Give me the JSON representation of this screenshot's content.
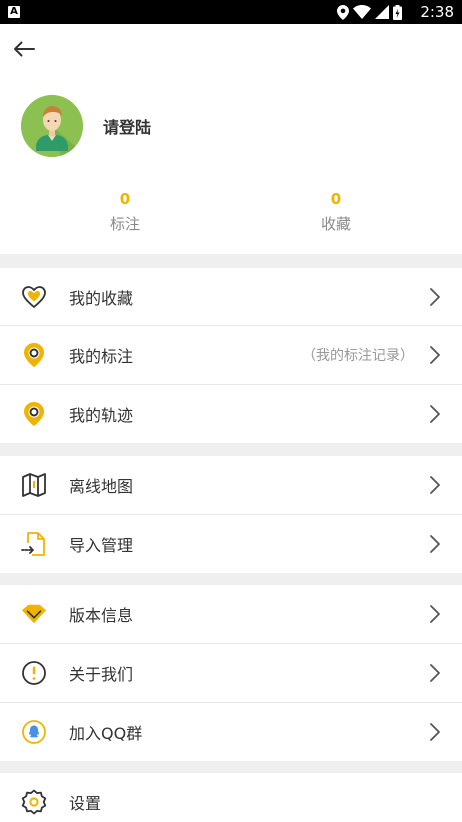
{
  "status_bar": {
    "notification_icon": "A",
    "time": "2:38",
    "icons": [
      "location-icon",
      "wifi-icon",
      "signal-icon",
      "battery-icon"
    ]
  },
  "header": {
    "back_icon": "arrow-left-icon"
  },
  "profile": {
    "name": "请登陆",
    "avatar_icon": "user-avatar-icon"
  },
  "stats": [
    {
      "value": "0",
      "label": "标注"
    },
    {
      "value": "0",
      "label": "收藏"
    }
  ],
  "menu_groups": [
    [
      {
        "label": "我的收藏",
        "icon": "heart-icon",
        "hint": ""
      },
      {
        "label": "我的标注",
        "icon": "map-pin-icon",
        "hint": "（我的标注记录）"
      },
      {
        "label": "我的轨迹",
        "icon": "map-pin-icon",
        "hint": ""
      }
    ],
    [
      {
        "label": "离线地图",
        "icon": "map-icon",
        "hint": ""
      },
      {
        "label": "导入管理",
        "icon": "file-import-icon",
        "hint": ""
      }
    ],
    [
      {
        "label": "版本信息",
        "icon": "diamond-icon",
        "hint": ""
      },
      {
        "label": "关于我们",
        "icon": "info-icon",
        "hint": ""
      },
      {
        "label": "加入QQ群",
        "icon": "qq-icon",
        "hint": ""
      }
    ],
    [
      {
        "label": "设置",
        "icon": "gear-icon",
        "hint": ""
      }
    ]
  ],
  "colors": {
    "accent": "#f0b400",
    "avatar_bg": "#8cc152",
    "section_gap": "#efefef"
  }
}
